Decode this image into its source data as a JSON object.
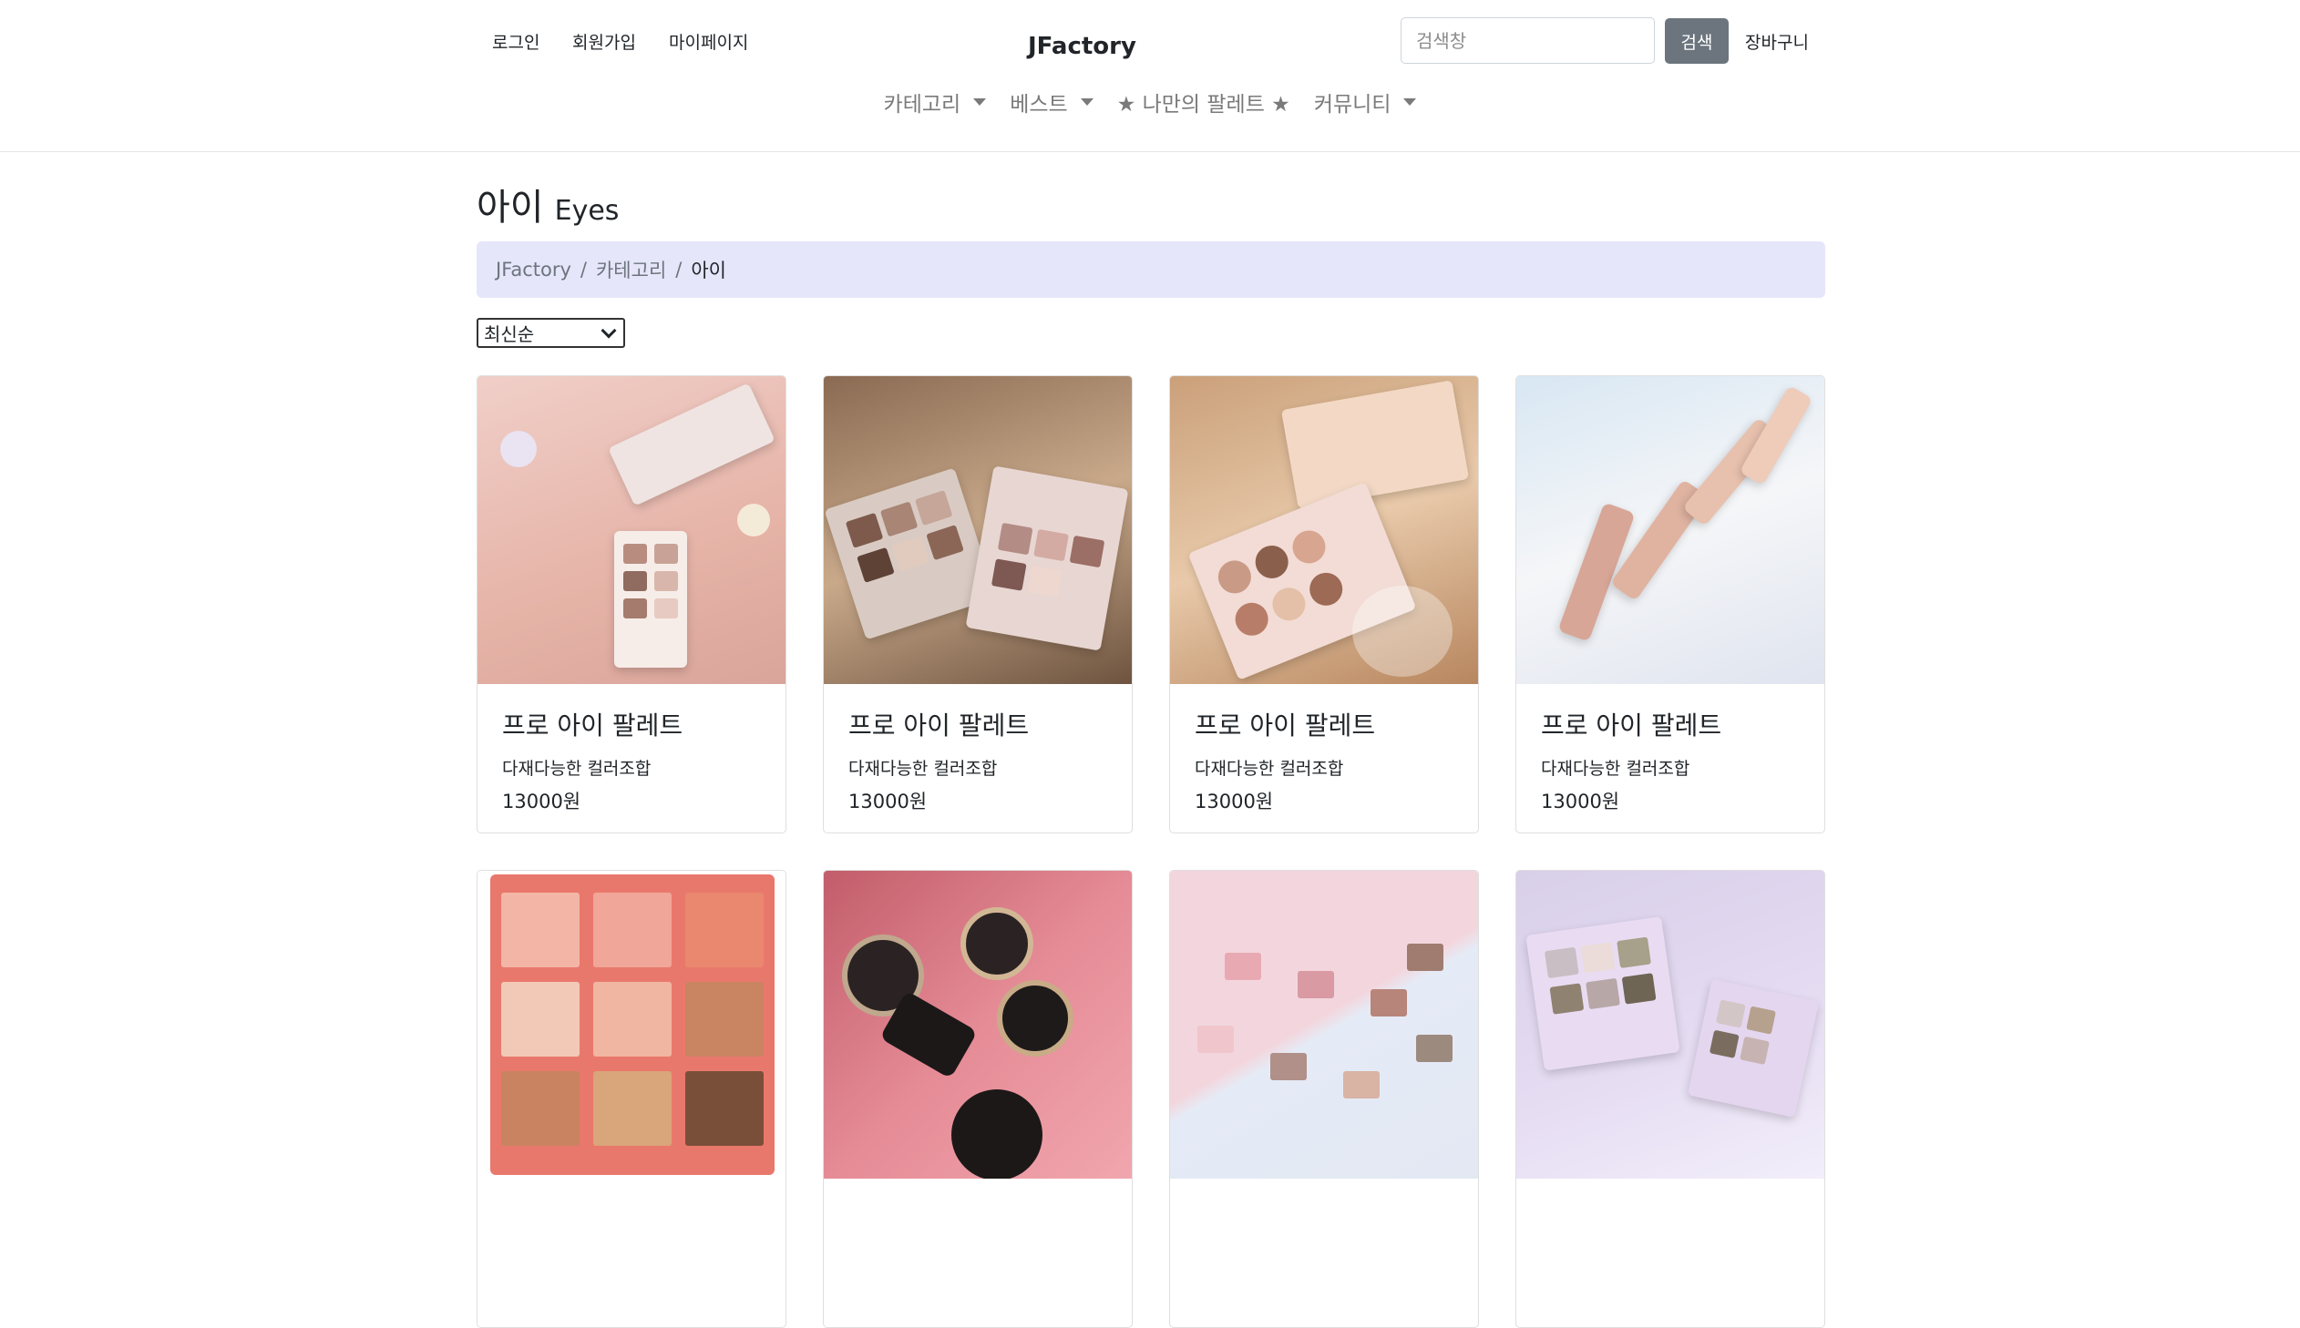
{
  "header": {
    "login": "로그인",
    "signup": "회원가입",
    "mypage": "마이페이지",
    "brand": "JFactory",
    "search_placeholder": "검색창",
    "search_button": "검색",
    "cart": "장바구니"
  },
  "menu": [
    {
      "label": "카테고리",
      "icon": "caret-down-icon"
    },
    {
      "label": "베스트",
      "icon": "caret-down-icon"
    },
    {
      "label": "★ 나만의 팔레트 ★"
    },
    {
      "label": "커뮤니티",
      "icon": "caret-down-icon"
    }
  ],
  "page": {
    "title": "아이",
    "subtitle": "Eyes"
  },
  "breadcrumb": [
    "JFactory",
    "카테고리",
    "아이"
  ],
  "sort": {
    "selected": "최신순"
  },
  "products": [
    {
      "name": "프로 아이 팔레트",
      "desc": "다재다능한 컬러조합",
      "price": "13000원"
    },
    {
      "name": "프로 아이 팔레트",
      "desc": "다재다능한 컬러조합",
      "price": "13000원"
    },
    {
      "name": "프로 아이 팔레트",
      "desc": "다재다능한 컬러조합",
      "price": "13000원"
    },
    {
      "name": "프로 아이 팔레트",
      "desc": "다재다능한 컬러조합",
      "price": "13000원"
    },
    {
      "name": "",
      "desc": "",
      "price": ""
    },
    {
      "name": "",
      "desc": "",
      "price": ""
    },
    {
      "name": "",
      "desc": "",
      "price": ""
    },
    {
      "name": "",
      "desc": "",
      "price": ""
    }
  ],
  "colors": {
    "breadcrumb_bg": "#e6e6fa",
    "search_button_bg": "#6c757d",
    "menu_text": "#7a7a7a"
  }
}
